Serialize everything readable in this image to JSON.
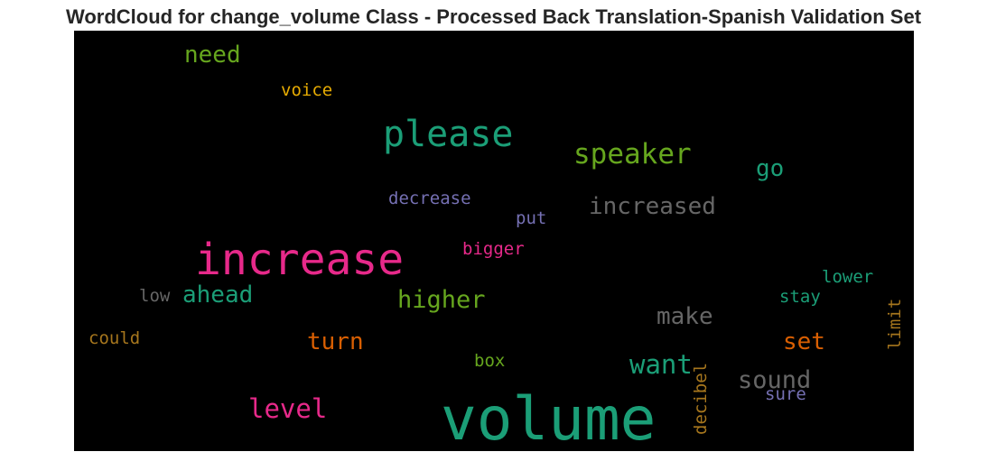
{
  "chart_data": {
    "type": "wordcloud",
    "title": "WordCloud for change_volume Class - Processed Back Translation-Spanish Validation Set",
    "words": [
      {
        "text": "volume",
        "color": "#1b9e77"
      },
      {
        "text": "increase",
        "color": "#e7298a"
      },
      {
        "text": "please",
        "color": "#1b9e77"
      },
      {
        "text": "speaker",
        "color": "#66a61e"
      },
      {
        "text": "increased",
        "color": "#666666"
      },
      {
        "text": "level",
        "color": "#e7298a"
      },
      {
        "text": "want",
        "color": "#1b9e77"
      },
      {
        "text": "higher",
        "color": "#66a61e"
      },
      {
        "text": "ahead",
        "color": "#1b9e77"
      },
      {
        "text": "sound",
        "color": "#666666"
      },
      {
        "text": "need",
        "color": "#66a61e"
      },
      {
        "text": "turn",
        "color": "#d95f02"
      },
      {
        "text": "make",
        "color": "#666666"
      },
      {
        "text": "set",
        "color": "#d95f02"
      },
      {
        "text": "go",
        "color": "#1b9e77"
      },
      {
        "text": "decrease",
        "color": "#7570b3"
      },
      {
        "text": "voice",
        "color": "#e6ab02"
      },
      {
        "text": "bigger",
        "color": "#e7298a"
      },
      {
        "text": "decibel",
        "color": "#a6761d"
      },
      {
        "text": "lower",
        "color": "#1b9e77"
      },
      {
        "text": "put",
        "color": "#7570b3"
      },
      {
        "text": "stay",
        "color": "#1b9e77"
      },
      {
        "text": "limit",
        "color": "#a6761d"
      },
      {
        "text": "could",
        "color": "#a6761d"
      },
      {
        "text": "low",
        "color": "#666666"
      },
      {
        "text": "box",
        "color": "#66a61e"
      },
      {
        "text": "sure",
        "color": "#7570b3"
      }
    ]
  }
}
